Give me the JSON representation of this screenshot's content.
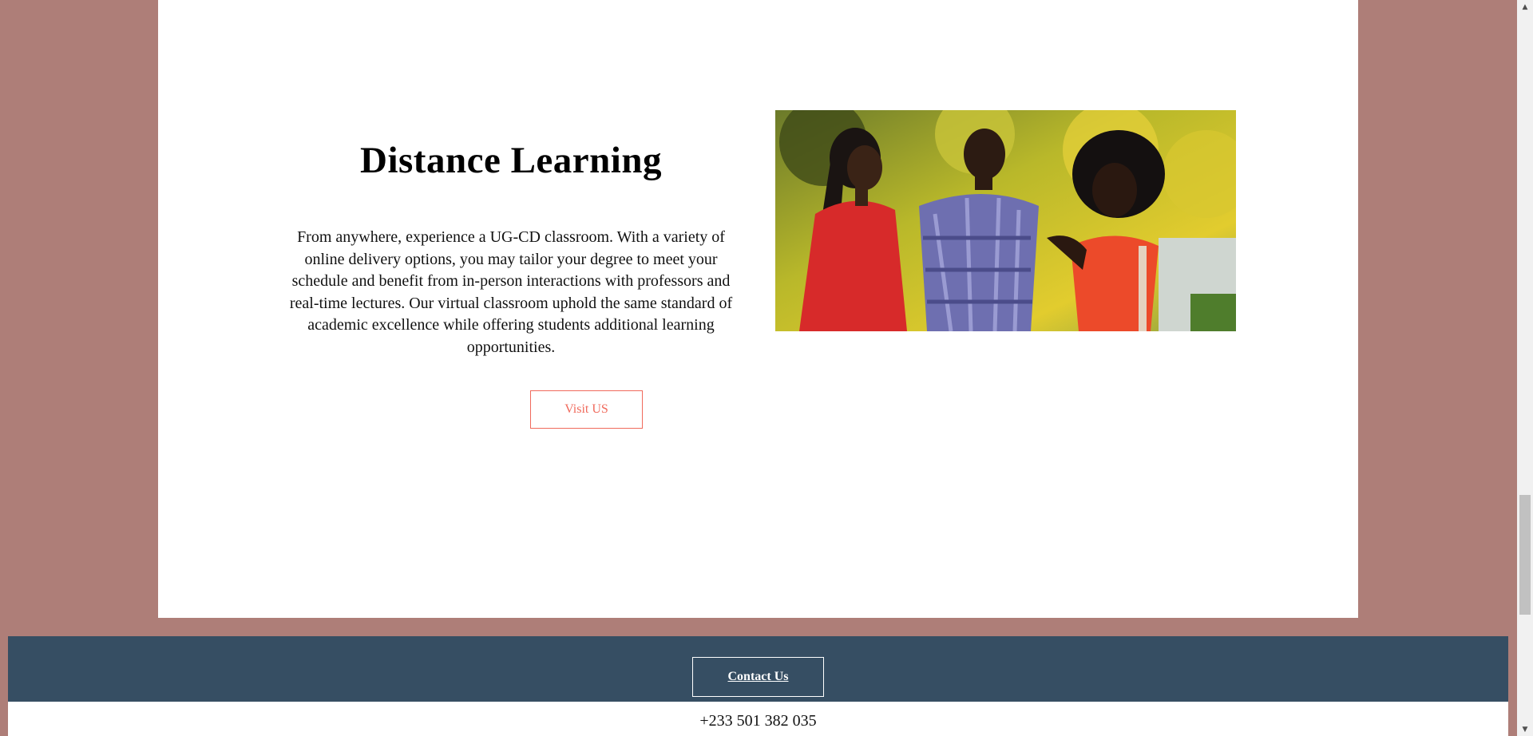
{
  "section": {
    "heading": "Distance Learning",
    "body": "From anywhere, experience a UG-CD classroom. With a variety of online delivery options, you may tailor your degree to meet your schedule and benefit from in-person interactions with professors and real-time lectures. Our virtual classroom uphold the same standard of academic excellence while offering students additional learning opportunities.",
    "button_label": "Visit US",
    "image_icon": "photo-students-outdoors"
  },
  "footer": {
    "contact_label": "Contact Us",
    "phone": "+233 501 382 035"
  },
  "colors": {
    "page_background": "#ae7e78",
    "card_background": "#ffffff",
    "accent": "#f06a5c",
    "footer_bar": "#364e63"
  },
  "scrollbar": {
    "up_icon": "scroll-up-arrow-icon",
    "down_icon": "scroll-down-arrow-icon"
  }
}
